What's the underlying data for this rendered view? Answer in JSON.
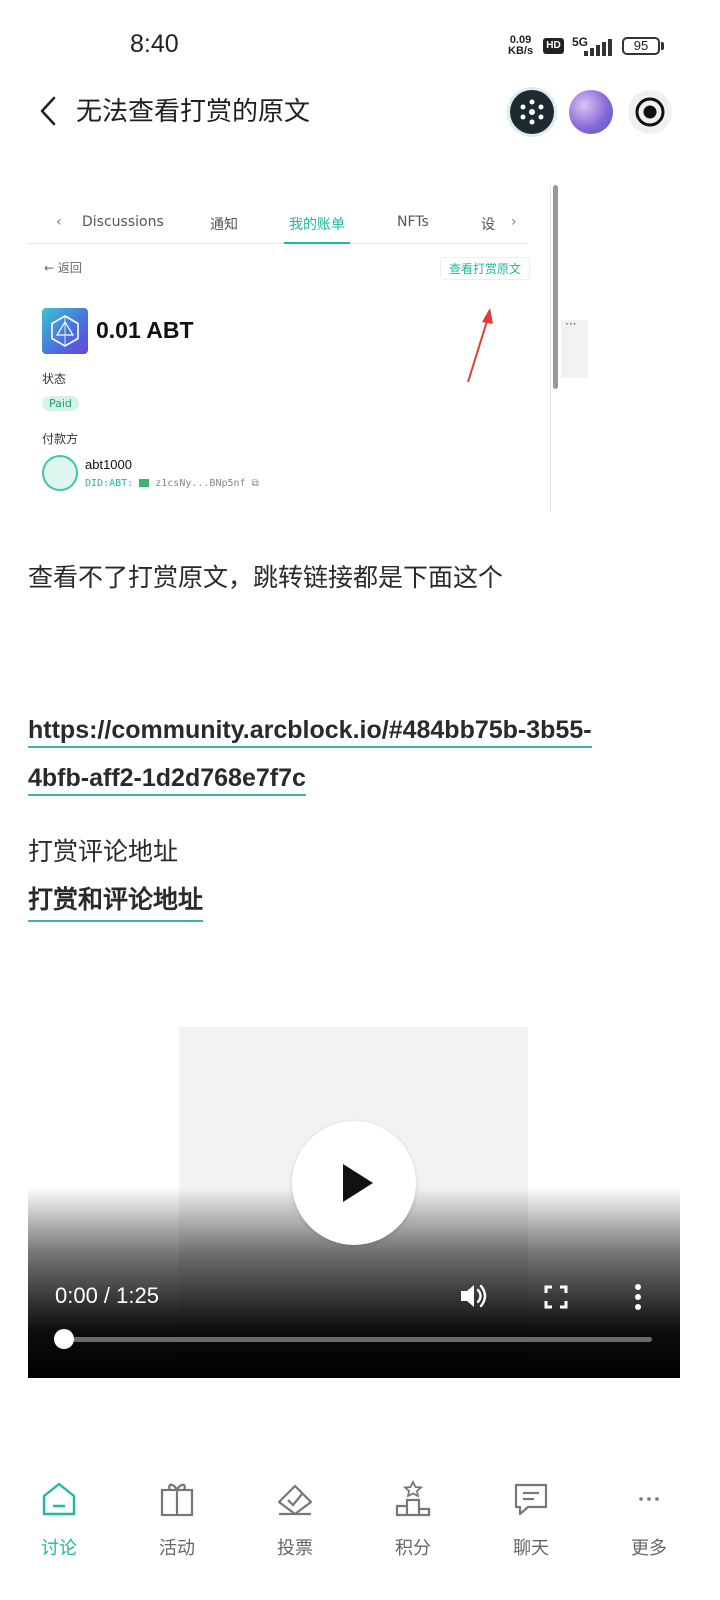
{
  "status_bar": {
    "time": "8:40",
    "net_speed_value": "0.09",
    "net_speed_unit": "KB/s",
    "hd": "HD",
    "network": "5G",
    "battery": "95"
  },
  "header": {
    "title": "无法查看打赏的原文"
  },
  "screenshot": {
    "tabs": [
      "Discussions",
      "通知",
      "我的账单",
      "NFTs",
      "设"
    ],
    "active_tab": "我的账单",
    "back_label": "返回",
    "view_original_label": "查看打赏原文",
    "amount": "0.01 ABT",
    "status_label": "状态",
    "status_value": "Paid",
    "payer_label": "付款方",
    "payer_name": "abt1000",
    "payer_did_prefix": "DID:ABT:",
    "payer_did_rest": "z1csNy...BNp5nf",
    "side_dots": "···"
  },
  "article": {
    "paragraph_1": "查看不了打赏原文，跳转链接都是下面这个",
    "link_line_1": "https://community.arcblock.io/#484bb75b-3b55-",
    "link_line_2": "4bfb-aff2-1d2d768e7f7c",
    "paragraph_2": "打赏评论地址",
    "link_2": "打赏和评论地址"
  },
  "video": {
    "time": "0:00 / 1:25",
    "progress": 0
  },
  "bottom_nav": {
    "items": [
      {
        "label": "讨论",
        "icon": "home-icon",
        "active": true
      },
      {
        "label": "活动",
        "icon": "gift-icon",
        "active": false
      },
      {
        "label": "投票",
        "icon": "vote-icon",
        "active": false
      },
      {
        "label": "积分",
        "icon": "podium-icon",
        "active": false
      },
      {
        "label": "聊天",
        "icon": "chat-icon",
        "active": false
      },
      {
        "label": "更多",
        "icon": "more-icon",
        "active": false
      }
    ]
  },
  "colors": {
    "accent": "#1fb8a0",
    "link_underline": "#3cb6a6"
  }
}
